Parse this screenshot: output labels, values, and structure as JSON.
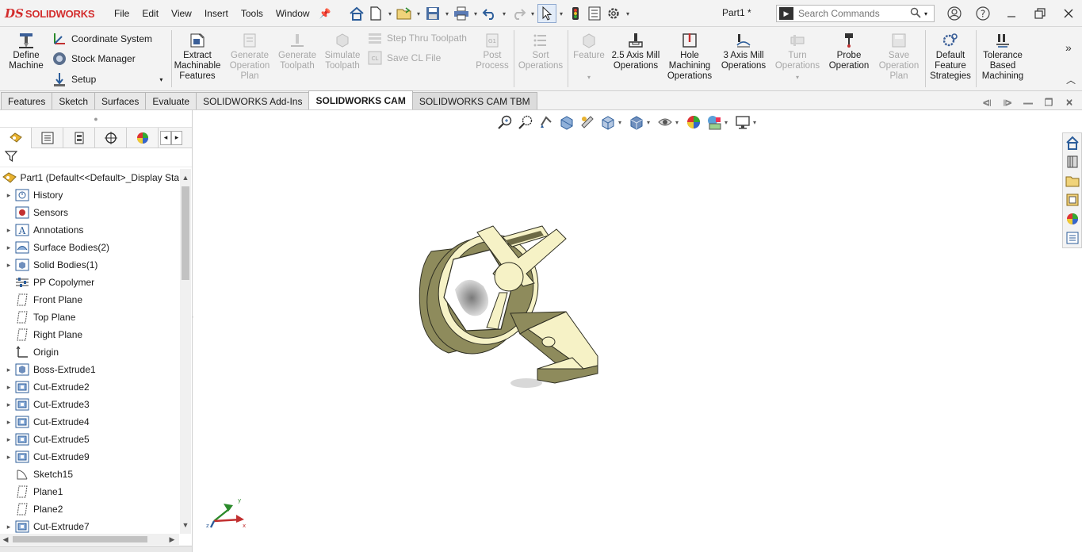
{
  "app": {
    "logo_mark": "DS",
    "logo_text": "SOLIDWORKS",
    "document_title": "Part1 *"
  },
  "menu": [
    "File",
    "Edit",
    "View",
    "Insert",
    "Tools",
    "Window"
  ],
  "search": {
    "placeholder": "Search Commands"
  },
  "ribbon": {
    "define_machine": "Define Machine",
    "coordinate_system": "Coordinate System",
    "stock_manager": "Stock Manager",
    "setup": "Setup",
    "extract_features": "Extract Machinable Features",
    "generate_operation_plan": "Generate Operation Plan",
    "generate_toolpath": "Generate Toolpath",
    "simulate_toolpath": "Simulate Toolpath",
    "step_thru_toolpath": "Step Thru Toolpath",
    "save_cl_file": "Save CL File",
    "post_process": "Post Process",
    "sort_operations": "Sort Operations",
    "feature": "Feature",
    "axis_25_mill": "2.5 Axis Mill Operations",
    "hole_machining": "Hole Machining Operations",
    "axis_3_mill": "3 Axis Mill Operations",
    "turn_operations": "Turn Operations",
    "probe_operation": "Probe Operation",
    "save_operation_plan": "Save Operation Plan",
    "default_feature_strategies": "Default Feature Strategies",
    "tolerance_based_machining": "Tolerance Based Machining"
  },
  "tabs": [
    {
      "label": "Features"
    },
    {
      "label": "Sketch"
    },
    {
      "label": "Surfaces"
    },
    {
      "label": "Evaluate"
    },
    {
      "label": "SOLIDWORKS Add-Ins"
    },
    {
      "label": "SOLIDWORKS CAM"
    },
    {
      "label": "SOLIDWORKS CAM TBM"
    }
  ],
  "tree": {
    "root": "Part1  (Default<<Default>_Display Sta",
    "items": [
      {
        "label": "History",
        "icon": "history-icon"
      },
      {
        "label": "Sensors",
        "icon": "sensors-icon"
      },
      {
        "label": "Annotations",
        "icon": "annotations-icon"
      },
      {
        "label": "Surface Bodies(2)",
        "icon": "surface-bodies-icon"
      },
      {
        "label": "Solid Bodies(1)",
        "icon": "solid-bodies-icon"
      },
      {
        "label": "PP Copolymer",
        "icon": "material-icon"
      },
      {
        "label": "Front Plane",
        "icon": "plane-icon"
      },
      {
        "label": "Top Plane",
        "icon": "plane-icon"
      },
      {
        "label": "Right Plane",
        "icon": "plane-icon"
      },
      {
        "label": "Origin",
        "icon": "origin-icon"
      },
      {
        "label": "Boss-Extrude1",
        "icon": "extrude-icon"
      },
      {
        "label": "Cut-Extrude2",
        "icon": "cut-extrude-icon"
      },
      {
        "label": "Cut-Extrude3",
        "icon": "cut-extrude-icon"
      },
      {
        "label": "Cut-Extrude4",
        "icon": "cut-extrude-icon"
      },
      {
        "label": "Cut-Extrude5",
        "icon": "cut-extrude-icon"
      },
      {
        "label": "Cut-Extrude9",
        "icon": "cut-extrude-icon"
      },
      {
        "label": "Sketch15",
        "icon": "sketch-icon"
      },
      {
        "label": "Plane1",
        "icon": "plane-icon"
      },
      {
        "label": "Plane2",
        "icon": "plane-icon"
      },
      {
        "label": "Cut-Extrude7",
        "icon": "cut-extrude-icon"
      }
    ]
  },
  "colors": {
    "brand": "#d32d2d",
    "model_face": "#f6f2c6",
    "model_side": "#8e8b5c",
    "selection_blue": "#2f6fb5"
  }
}
